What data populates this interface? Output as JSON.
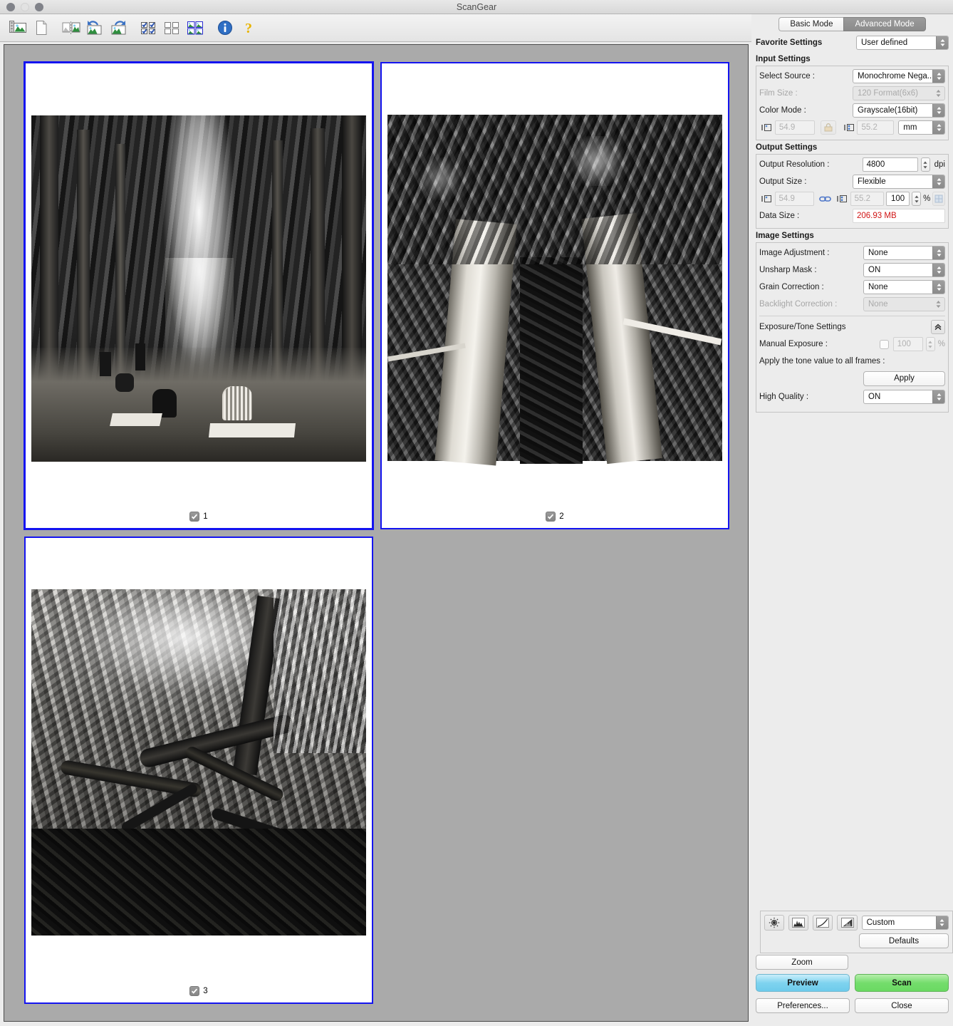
{
  "window": {
    "title": "ScanGear",
    "traffic_lights": [
      "close-button",
      "minimize-button",
      "zoom-button"
    ]
  },
  "toolbar": {
    "items": [
      {
        "name": "select-all-frames-icon",
        "tip": "Select All Frames"
      },
      {
        "name": "clear-frame-icon",
        "tip": "Clear Frame"
      },
      {
        "name": "mirror-image-icon",
        "tip": "Mirror Image"
      },
      {
        "name": "rotate-left-icon",
        "tip": "Rotate Left"
      },
      {
        "name": "rotate-right-icon",
        "tip": "Rotate Right"
      },
      {
        "name": "check-all-frames-icon",
        "tip": "Check All Frames"
      },
      {
        "name": "uncheck-all-frames-icon",
        "tip": "Uncheck All Frames"
      },
      {
        "name": "select-all-thumbnails-icon",
        "tip": "Select All Thumbnails"
      },
      {
        "name": "info-icon",
        "tip": "Information"
      },
      {
        "name": "help-icon",
        "tip": "Help"
      }
    ]
  },
  "preview": {
    "background_color": "#aaaaaa",
    "frame_color": "#1414f0",
    "thumbnails": [
      {
        "index": "1",
        "checked": true,
        "selected": true,
        "caption": "1",
        "alt": "black and white photo of people sitting under an avenue of tall trees"
      },
      {
        "index": "2",
        "checked": true,
        "selected": false,
        "caption": "2",
        "alt": "black and white photo looking up twin tree trunks into the forest canopy"
      },
      {
        "index": "3",
        "checked": true,
        "selected": false,
        "caption": "3",
        "alt": "black and white photo of a gnarled spreading tree branch against bright foliage"
      }
    ]
  },
  "panel": {
    "tabs": [
      {
        "label": "Basic Mode",
        "active": false
      },
      {
        "label": "Advanced Mode",
        "active": true
      }
    ],
    "favorite_settings": {
      "label": "Favorite Settings",
      "value": "User defined"
    },
    "input_settings": {
      "header": "Input Settings",
      "select_source": {
        "label": "Select Source :",
        "value": "Monochrome Nega...",
        "disabled": false
      },
      "film_size": {
        "label": "Film Size :",
        "value": "120 Format(6x6)",
        "disabled": true
      },
      "color_mode": {
        "label": "Color Mode :",
        "value": "Grayscale(16bit)",
        "disabled": false
      },
      "dimensions": {
        "width_icon": "width-icon",
        "width": "54.9",
        "lock_icon": "aspect-lock-icon",
        "height_icon": "height-icon",
        "height": "55.2",
        "unit": "mm"
      }
    },
    "output_settings": {
      "header": "Output Settings",
      "output_resolution": {
        "label": "Output Resolution :",
        "value": "4800",
        "unit": "dpi"
      },
      "output_size": {
        "label": "Output Size :",
        "value": "Flexible"
      },
      "dimensions": {
        "width_icon": "width-icon",
        "width": "54.9",
        "chain_icon": "chain-link-icon",
        "height_icon": "height-icon",
        "height": "55.2",
        "scale": "100",
        "scale_unit": "%",
        "reset_icon": "reset-size-icon"
      },
      "data_size": {
        "label": "Data Size :",
        "value": "206.93 MB",
        "color": "#d01414"
      }
    },
    "image_settings": {
      "header": "Image Settings",
      "image_adjustment": {
        "label": "Image Adjustment :",
        "value": "None",
        "disabled": false
      },
      "unsharp_mask": {
        "label": "Unsharp Mask :",
        "value": "ON",
        "disabled": false
      },
      "grain_correction": {
        "label": "Grain Correction :",
        "value": "None",
        "disabled": false
      },
      "backlight_correction": {
        "label": "Backlight Correction :",
        "value": "None",
        "disabled": true
      },
      "exposure_tone": {
        "label": "Exposure/Tone Settings",
        "disclosure_icon": "chevron-double-up-icon"
      },
      "manual_exposure": {
        "label": "Manual Exposure :",
        "checked": false,
        "value": "100",
        "unit": "%",
        "disabled": true
      },
      "apply_tone": {
        "label": "Apply the tone value to all frames :",
        "button": "Apply"
      },
      "high_quality": {
        "label": "High Quality :",
        "value": "ON"
      }
    },
    "tone_tools": {
      "icons": [
        {
          "name": "brightness-contrast-icon"
        },
        {
          "name": "histogram-icon"
        },
        {
          "name": "tone-curve-icon"
        },
        {
          "name": "final-review-icon"
        }
      ],
      "preset": "Custom",
      "defaults_button": "Defaults"
    },
    "actions": {
      "zoom": "Zoom",
      "preview": "Preview",
      "scan": "Scan",
      "preferences": "Preferences...",
      "close": "Close"
    }
  }
}
